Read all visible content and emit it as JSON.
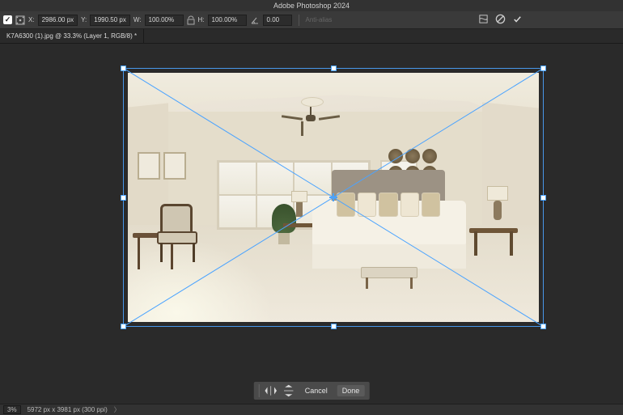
{
  "app": {
    "title": "Adobe Photoshop 2024"
  },
  "optionsbar": {
    "x_label": "X:",
    "x_value": "2986.00 px",
    "y_label": "Y:",
    "y_value": "1990.50 px",
    "w_label": "W:",
    "w_value": "100.00%",
    "h_label": "H:",
    "h_value": "100.00%",
    "angle_value": "0.00",
    "antialias_label": "Anti-alias"
  },
  "document": {
    "tab_title": "K7A6300 (1).jpg @ 33.3% (Layer 1, RGB/8) *"
  },
  "confirm": {
    "cancel": "Cancel",
    "done": "Done"
  },
  "statusbar": {
    "zoom": "3%",
    "doc_info": "5972 px x 3981 px (300 ppi)"
  }
}
